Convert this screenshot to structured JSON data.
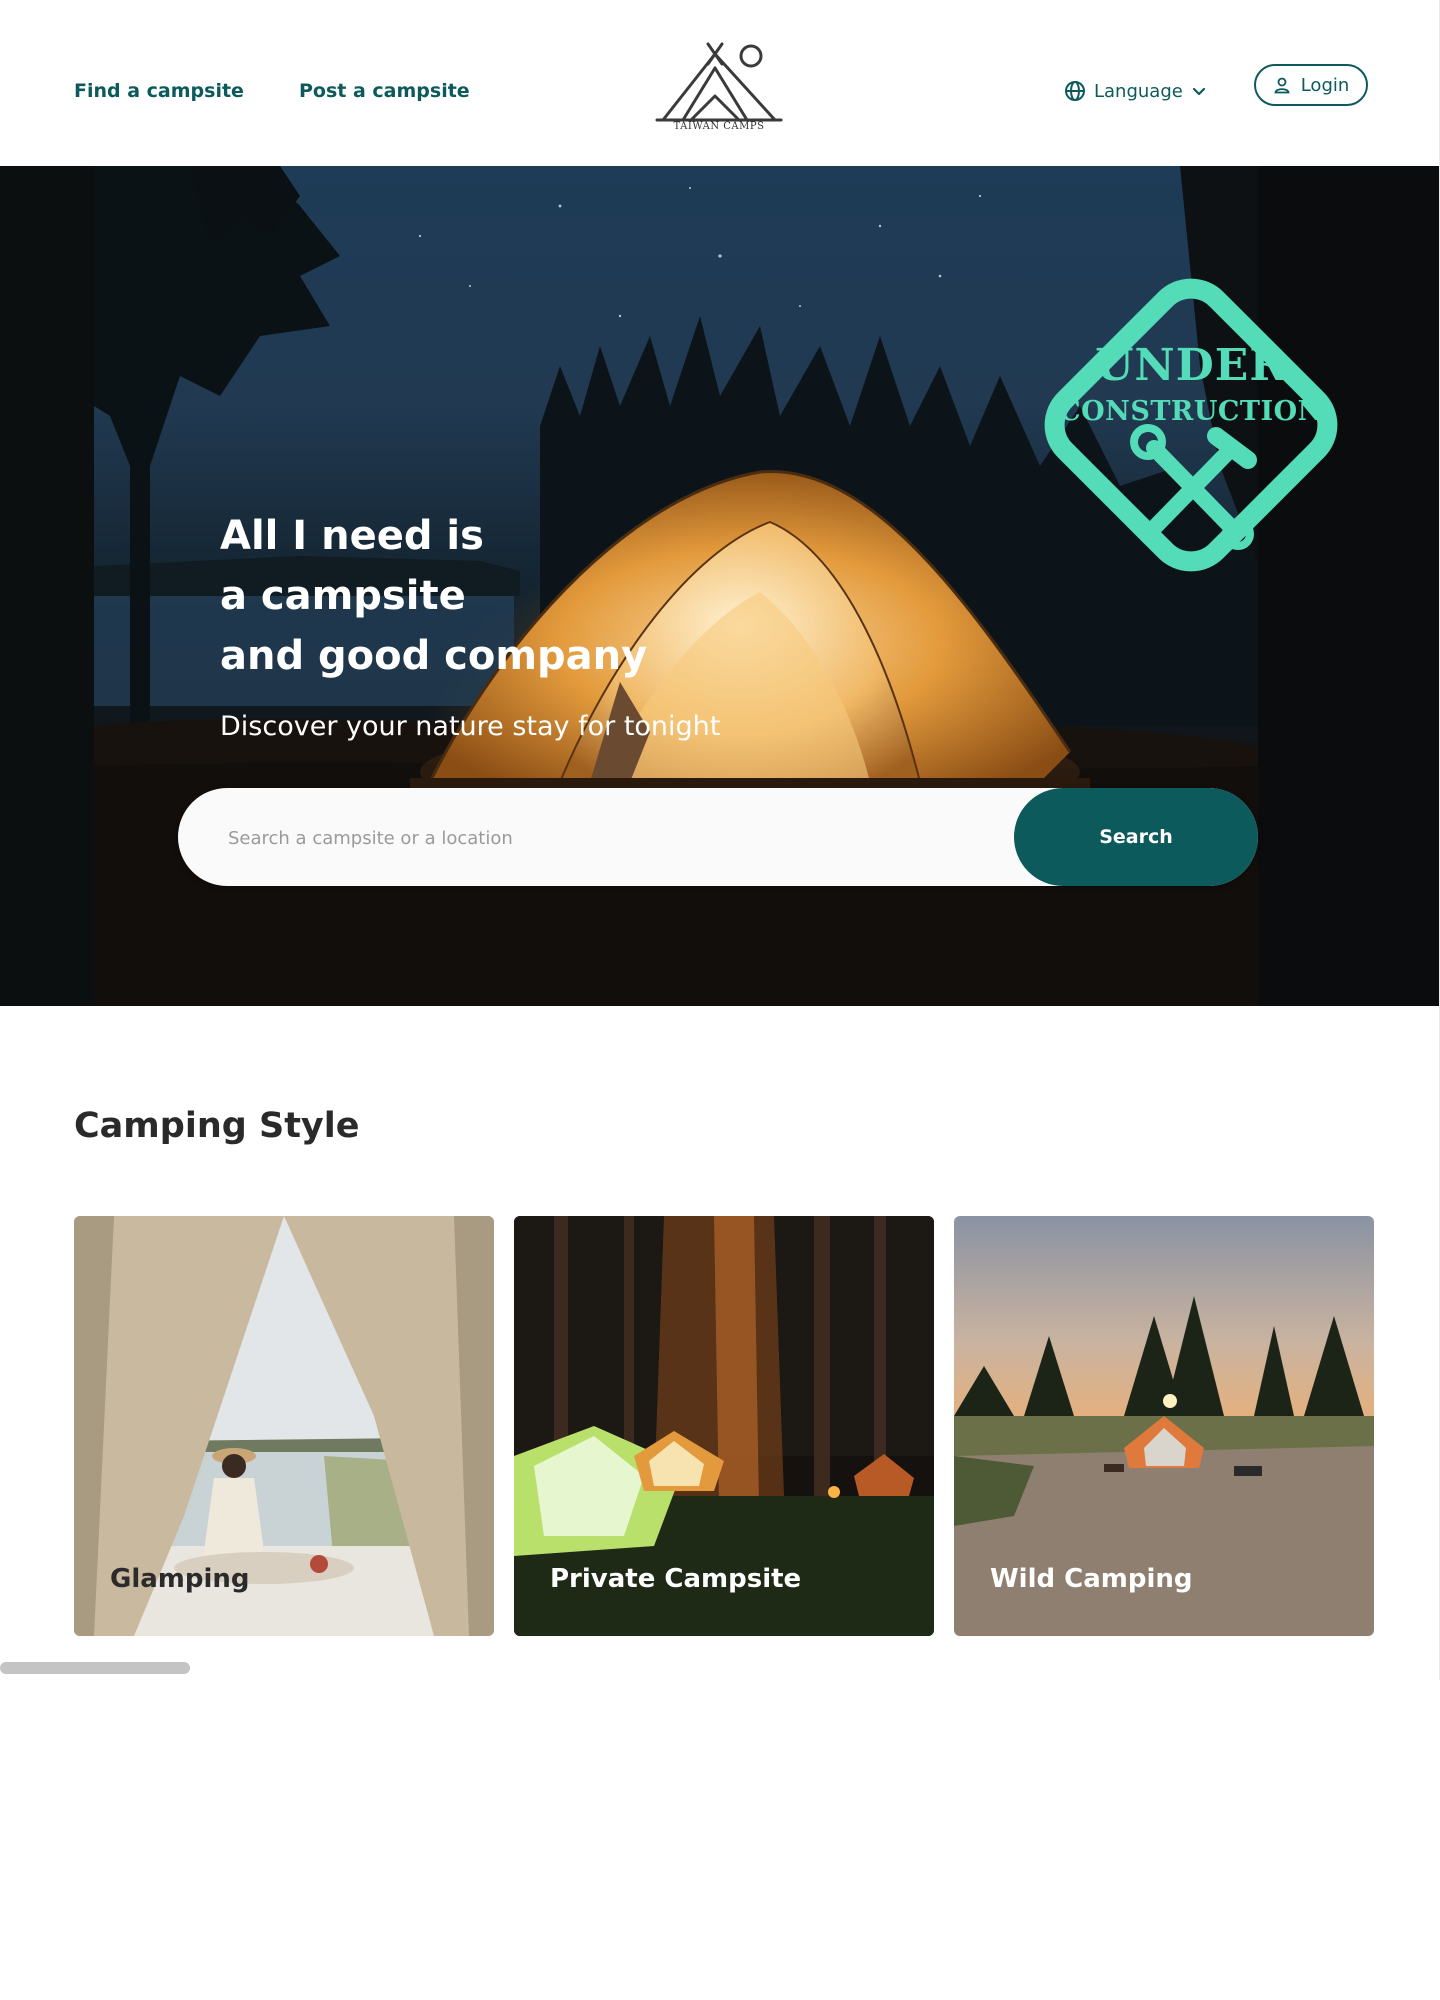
{
  "header": {
    "nav": {
      "find_label": "Find a campsite",
      "post_label": "Post a campsite"
    },
    "logo_text": "TAIWAN CAMPS",
    "language_label": "Language",
    "login_label": "Login"
  },
  "hero": {
    "title_lines": [
      "All I need is",
      "a campsite",
      "and good company"
    ],
    "subtitle": "Discover your nature stay for tonight",
    "stamp": {
      "line1": "UNDER",
      "line2": "CONSTRUCTION"
    },
    "search": {
      "placeholder": "Search a campsite or a location",
      "button_label": "Search"
    }
  },
  "camping_style": {
    "title": "Camping Style",
    "cards": [
      {
        "label": "Glamping"
      },
      {
        "label": "Private Campsite"
      },
      {
        "label": "Wild Camping"
      }
    ]
  },
  "colors": {
    "brand_teal": "#0c5a5c",
    "stamp_mint": "#53dcb7",
    "text_dark": "#2a2a2a"
  },
  "icons": {
    "language": "globe-icon",
    "language_caret": "chevron-down-icon",
    "login": "user-icon",
    "stamp_tools": "wrench-hammer-icon"
  }
}
